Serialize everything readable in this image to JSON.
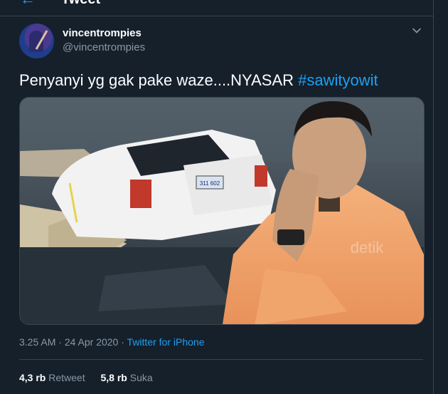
{
  "header": {
    "title": "Tweet"
  },
  "tweet": {
    "display_name": "vincentrompies",
    "handle": "@vincentrompies",
    "text_plain": "Penyanyi yg gak pake waze....NYASAR ",
    "hashtag": "#sawityowit",
    "time": "3.25 AM",
    "date": "24 Apr 2020",
    "source": "Twitter for iPhone",
    "separator": " · "
  },
  "stats": {
    "retweets_count": "4,3 rb",
    "retweets_label": "Retweet",
    "likes_count": "5,8 rb",
    "likes_label": "Suka"
  },
  "media": {
    "license_plate": "311 602",
    "watermark": "detik"
  },
  "colors": {
    "background": "#15202b",
    "accent": "#1da1f2",
    "muted": "#8899a6",
    "border": "#38444d"
  },
  "icons": {
    "back": "back-arrow-icon",
    "more": "chevron-down-icon"
  }
}
